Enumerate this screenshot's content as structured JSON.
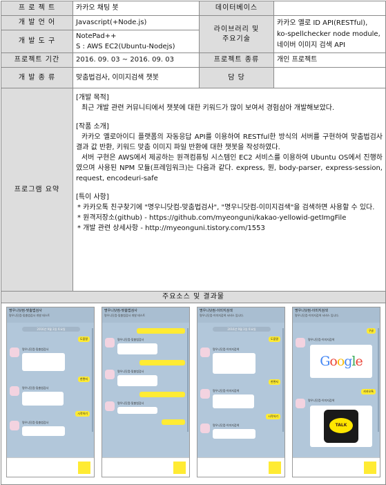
{
  "rows": {
    "project": {
      "label": "프 로 젝 트",
      "value": "카카오 채팅 봇"
    },
    "database": {
      "label": "데이터베이스",
      "value": ""
    },
    "language": {
      "label": "개 발 언 어",
      "value": "Javascript(+Node.js)"
    },
    "library": {
      "label": "라이브러리 및\n주요기술",
      "value": "카카오 옐로 ID API(RESTful),\nko-spellchecker node module,\n네이버 이미지 검색 API"
    },
    "tools": {
      "label": "개 발 도 구",
      "value": "NotePad++\nS : AWS EC2(Ubuntu-Nodejs)"
    },
    "period": {
      "label": "프로젝트 기간",
      "value": "2016. 09. 03 ~ 2016. 09. 03"
    },
    "kind": {
      "label": "프로젝트 종류",
      "value": "개인 프로젝트"
    },
    "type": {
      "label": "개 발 종 류",
      "value": "맞춤법검사, 이미지검색 챗봇"
    },
    "owner": {
      "label": "담 당",
      "value": ""
    },
    "summary": {
      "label": "프로그램 요약"
    }
  },
  "summary": {
    "purpose_head": "[개발 목적]",
    "purpose": "최근 개발 관련 커뮤니티에서 챗봇에 대한 키워드가 많이 보여서 경험삼아 개발해보았다.",
    "intro_head": "[작품 소개]",
    "intro1": "카카오 옐로아이디 플랫폼의 자동응답 API를 이용하여 RESTful한 방식의 서버를 구현하여 맞춤법검사 결과 값 반환, 키워드 맞춤 이미지 파일 반환에 대한 챗봇을 작성하였다.",
    "intro2": "서버 구현은 AWS에서 제공하는 원격컴퓨팅 시스템인 EC2 서비스를 이용하여 Ubuntu OS에서 진행하였으며 사용된 NPM 모듈(프레임워크)는 다음과 같다. express, 뭔, body-parser, express-session, request, encodeuri-safe",
    "notes_head": "[특이 사항]",
    "notes": [
      "* 카카오톡 친구찾기에 \"명우니닷컴-맞춤법검사\", \"명우니닷컴-이미지검색\"을 검색하면 사용할 수 있다.",
      "* 원격저장소(github) - https://github.com/myeonguni/kakao-yellowid-getImgFile",
      "* 개발 관련 상세사항 - http://myeonguni.tistory.com/1553"
    ]
  },
  "screens_title": "주요소스 및 결과물",
  "phones": [
    {
      "title": "명우니닷컴-맞춤법검사",
      "sub": "명우니닷컴-맞춤법검사 개발 테스트",
      "date": "2016년 9월 3일 토요일"
    },
    {
      "title": "명우니닷컴-맞춤법검사",
      "sub": "명우니닷컴-맞춤법검사 개발 테스트",
      "date": ""
    },
    {
      "title": "명우니닷컴-이미지검색",
      "sub": "명우니닷컴-이미지검색 서비스 입니다.",
      "date": "2016년 9월 3일 토요일"
    },
    {
      "title": "명우니닷컴-이미지검색",
      "sub": "명우니닷컴-이미지검색 서비스 입니다.",
      "date": ""
    }
  ],
  "bubbles": {
    "help": "도움말",
    "start": "한편지",
    "test": "시작하기",
    "kakao": "카카오톡",
    "google": "구글",
    "bot_name1": "명우니닷컴-맞춤법검사",
    "bot_name2": "명우니닷컴-이미지검색",
    "google_logo": "Google",
    "talk_logo": "TALK"
  }
}
